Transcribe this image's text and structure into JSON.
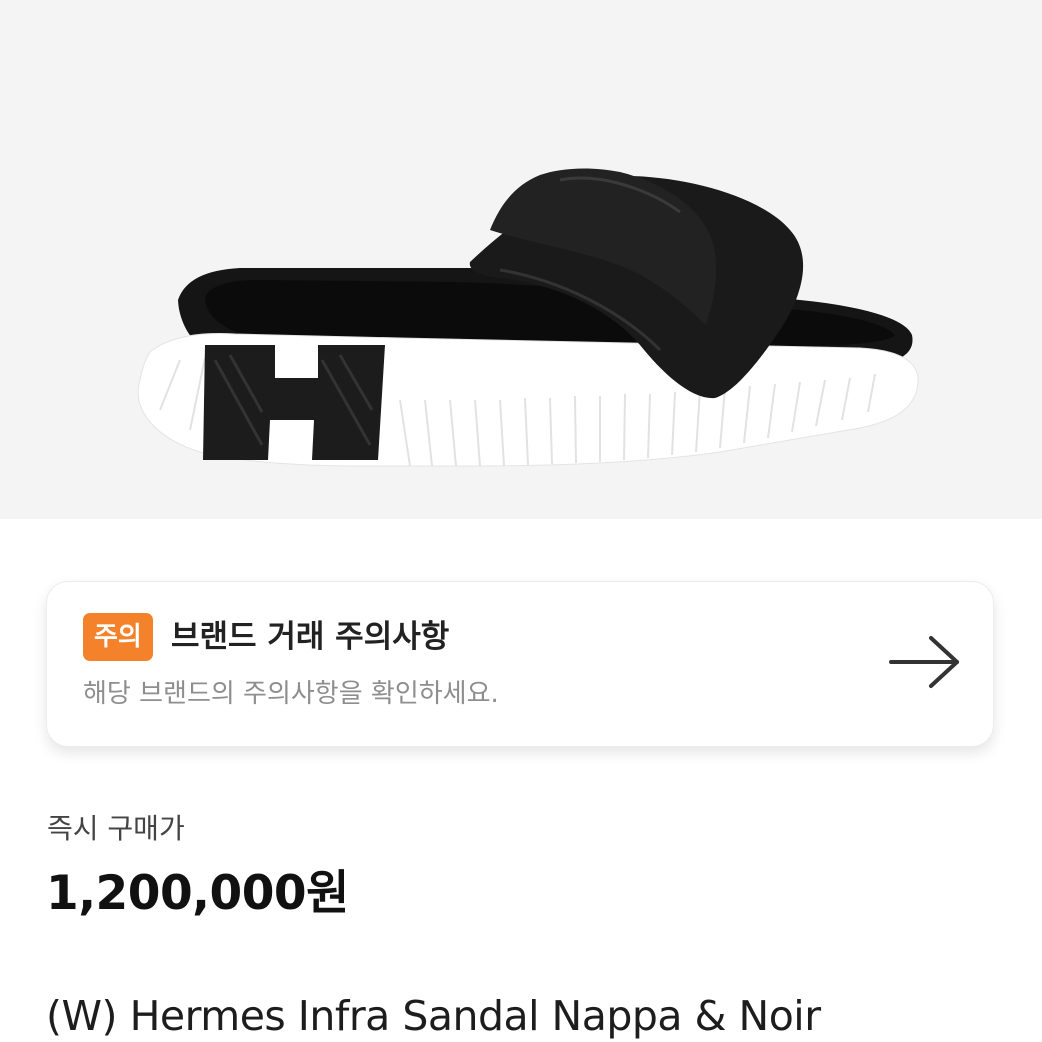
{
  "product_image": {
    "icon": "sandal-product-image"
  },
  "notice": {
    "badge": "주의",
    "title": "브랜드 거래 주의사항",
    "subtitle": "해당 브랜드의 주의사항을 확인하세요.",
    "arrow_icon": "arrow-right-icon",
    "badge_color": "#f4822a"
  },
  "price": {
    "label": "즉시 구매가",
    "value": "1,200,000원"
  },
  "product": {
    "name": "(W) Hermes Infra Sandal Nappa & Noir"
  }
}
